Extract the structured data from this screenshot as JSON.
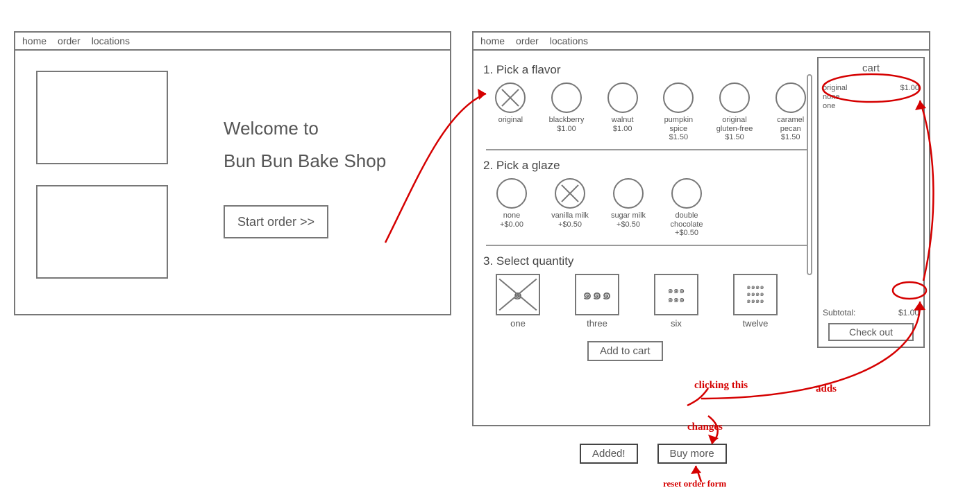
{
  "nav": {
    "home": "home",
    "order": "order",
    "locations": "locations"
  },
  "welcome": {
    "line1": "Welcome to",
    "line2": "Bun Bun Bake Shop",
    "start_button": "Start order >>"
  },
  "order": {
    "step1_title": "1. Pick a flavor",
    "flavors": [
      {
        "name": "original",
        "price": "",
        "selected": true
      },
      {
        "name": "blackberry",
        "price": "$1.00",
        "selected": false
      },
      {
        "name": "walnut",
        "price": "$1.00",
        "selected": false
      },
      {
        "name": "pumpkin spice",
        "price": "$1.50",
        "selected": false
      },
      {
        "name": "original gluten-free",
        "price": "$1.50",
        "selected": false
      },
      {
        "name": "caramel pecan",
        "price": "$1.50",
        "selected": false
      }
    ],
    "step2_title": "2. Pick a glaze",
    "glazes": [
      {
        "name": "none",
        "price": "+$0.00",
        "selected": false
      },
      {
        "name": "vanilla milk",
        "price": "+$0.50",
        "selected": true
      },
      {
        "name": "sugar milk",
        "price": "+$0.50",
        "selected": false
      },
      {
        "name": "double chocolate",
        "price": "+$0.50",
        "selected": false
      }
    ],
    "step3_title": "3. Select quantity",
    "quantities": [
      {
        "label": "one",
        "selected": true
      },
      {
        "label": "three",
        "selected": false
      },
      {
        "label": "six",
        "selected": false
      },
      {
        "label": "twelve",
        "selected": false
      }
    ],
    "add_button": "Add to cart"
  },
  "cart": {
    "title": "cart",
    "item_desc": "original\nnone\none",
    "item_price": "$1.00",
    "subtotal_label": "Subtotal:",
    "subtotal_value": "$1.00",
    "checkout": "Check out"
  },
  "after_state": {
    "added": "Added!",
    "buy_more": "Buy more"
  },
  "annotations": {
    "clicking_this": "clicking this",
    "adds": "adds",
    "changes": "changes",
    "reset": "reset order form"
  }
}
